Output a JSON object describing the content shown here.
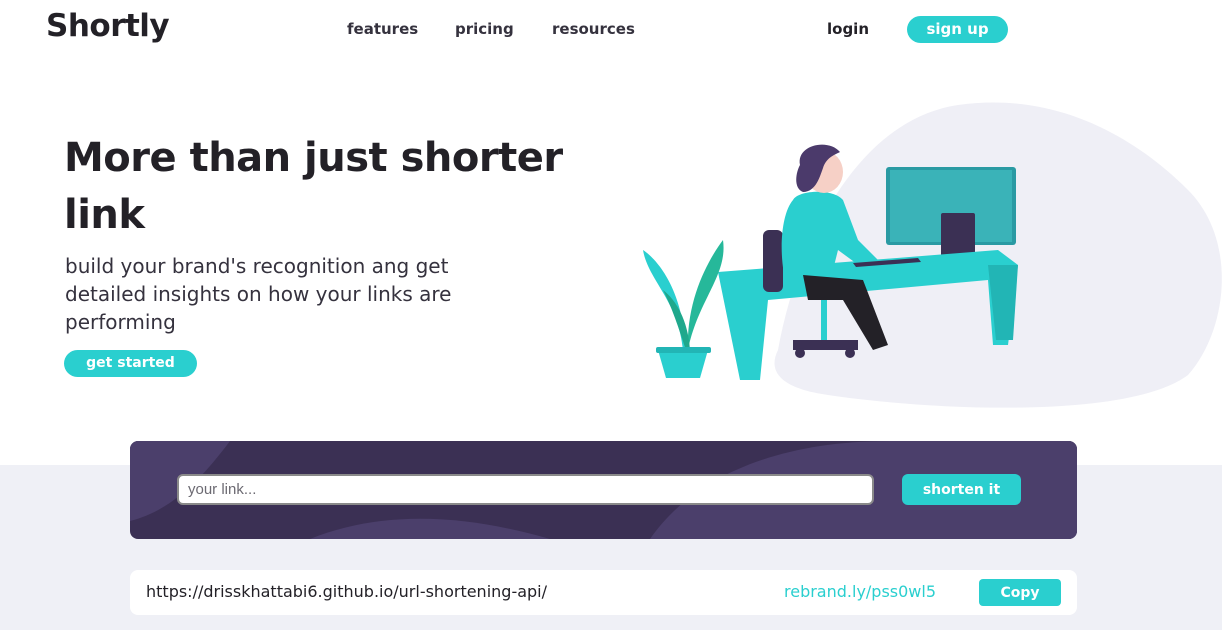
{
  "header": {
    "logo": "Shortly",
    "nav": {
      "features": "features",
      "pricing": "pricing",
      "resources": "resources"
    },
    "login": "login",
    "signup": "sign up"
  },
  "hero": {
    "title": "More than just shorter link",
    "subtitle": "build your brand's recognition ang get detailed insights on how your links are performing",
    "cta": "get started"
  },
  "shorten": {
    "placeholder": "your link...",
    "button": "shorten it"
  },
  "result": {
    "long_url": "https://drisskhattabi6.github.io/url-shortening-api/",
    "short_url": "rebrand.ly/pss0wl5",
    "copy": "Copy"
  },
  "colors": {
    "accent": "#2acfcf",
    "dark_violet": "#3b3054",
    "text": "#232127",
    "band": "#eff0f6"
  },
  "icons": [
    "person-working-illustration"
  ]
}
